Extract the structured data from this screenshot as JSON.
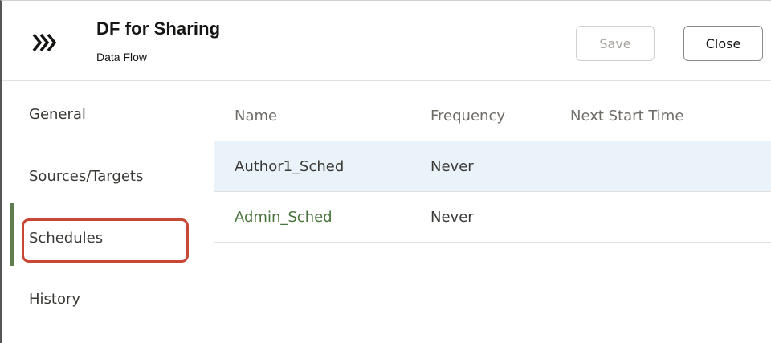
{
  "header": {
    "title": "DF for Sharing",
    "subtitle": "Data Flow",
    "icon": "data-flow-chevrons-icon",
    "save_label": "Save",
    "close_label": "Close"
  },
  "sidebar": {
    "items": [
      {
        "label": "General"
      },
      {
        "label": "Sources/Targets"
      },
      {
        "label": "Schedules",
        "active": true
      },
      {
        "label": "History"
      }
    ]
  },
  "table": {
    "columns": [
      "Name",
      "Frequency",
      "Next Start Time"
    ],
    "rows": [
      {
        "name": "Author1_Sched",
        "frequency": "Never",
        "next_start_time": "",
        "selected": true
      },
      {
        "name": "Admin_Sched",
        "frequency": "Never",
        "next_start_time": "",
        "selected": false
      }
    ]
  },
  "colors": {
    "accent_green": "#5f7d4f",
    "highlight_red": "#c74634",
    "selected_row": "#eaf3f9"
  }
}
